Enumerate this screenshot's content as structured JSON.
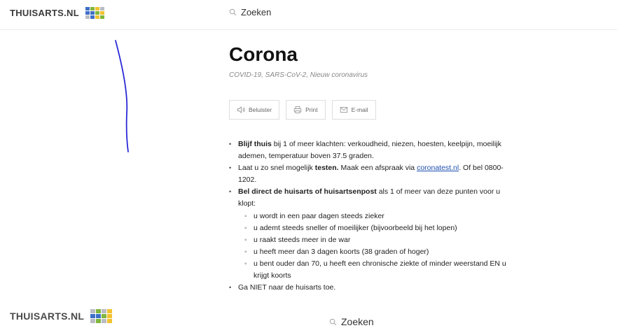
{
  "header": {
    "logo_text": "THUISARTS.NL",
    "search_label": "Zoeken"
  },
  "footer": {
    "logo_text": "THUISARTS.NL",
    "search_label": "Zoeken"
  },
  "logo_colors": {
    "blue": "#3f6fc7",
    "green": "#7fb63d",
    "yellow": "#f2c230",
    "gray": "#b9bcc2"
  },
  "annotation_color": "#2a2ad6",
  "article": {
    "title": "Corona",
    "subtitle": "COVID-19, SARS-CoV-2, Nieuw coronavirus",
    "actions": [
      {
        "label": "Beluister",
        "icon": "speaker-icon"
      },
      {
        "label": "Print",
        "icon": "printer-icon"
      },
      {
        "label": "E-mail",
        "icon": "mail-icon"
      }
    ],
    "b1_bold": "Blijf thuis",
    "b1_text": " bij 1 of meer klachten: verkoudheid, niezen, hoesten, keelpijn, moeilijk ademen, temperatuur boven 37.5 graden.",
    "b2_pre": "Laat u zo snel mogelijk ",
    "b2_bold": "testen.",
    "b2_mid": " Maak een afspraak via ",
    "b2_link": "coronatest.nl",
    "b2_post": ". Of bel 0800-1202.",
    "b3_bold": "Bel direct de huisarts of huisartsenpost",
    "b3_text": " als 1 of meer van deze punten voor u klopt:",
    "sub_items": [
      "u wordt in een paar dagen steeds zieker",
      "u ademt steeds sneller of moeilijker (bijvoorbeeld bij het lopen)",
      "u raakt steeds meer in de war",
      "u heeft meer dan 3 dagen koorts (38 graden of hoger)",
      "u bent ouder dan 70, u heeft een chronische ziekte of minder weerstand EN u krijgt koorts"
    ],
    "b4_text": "Ga NIET naar de huisarts toe."
  }
}
